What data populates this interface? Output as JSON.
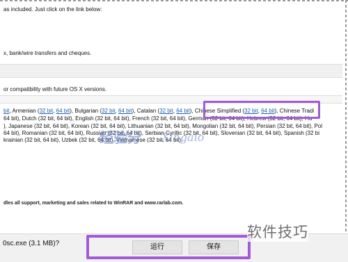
{
  "page_lines": {
    "intro": "as included. Just click on the link below:",
    "payment": "x, bank/wire transfers and cheques.",
    "compat": "or compatibility with future OS X versions."
  },
  "languages": {
    "row1": [
      {
        "prefix": ", Armenian (",
        "l1": "32 bit",
        "sep": ", ",
        "l2": "64 bit",
        "suffix": "), Bulgarian ("
      },
      {
        "prefix": "",
        "l1": "32 bit",
        "sep": ", ",
        "l2": "64 bit",
        "suffix": "), Catalan ("
      },
      {
        "prefix": "",
        "l1": "32 bit",
        "sep": ", ",
        "l2": "64 bit",
        "suffix": "), Chinese Simplified ("
      },
      {
        "prefix": "",
        "l1": "32 bit",
        "sep": ", ",
        "l2": "64 bit",
        "suffix": "), Chinese Tradi"
      }
    ],
    "row1_lead": "bit",
    "row2_text": "64 bit), Dutch (32 bit, 64 bit), English (32 bit, 64 bit), French (32 bit, 64 bit), German (32 bit, 64 bit), Hebrew (32 bit, 64 bit), Hu",
    "row3_text": "), Japanese (32 bit, 64 bit), Korean (32 bit, 64 bit), Lithuanian (32 bit, 64 bit), Mongolian (32 bit, 64 bit), Persian (32 bit, 64 bit), Pol",
    "row4_text": "64 bit), Romanian (32 bit, 64 bit), Russian (32 bit, 64 bit), Serbian Cyrillic (32 bit, 64 bit), Slovenian (32 bit, 64 bit), Spanish (32 bi",
    "row5_text": "krainian (32 bit, 64 bit), Uzbek (32 bit, 64 bit), Vietnamese (32 bit, 64 bit)."
  },
  "footer": {
    "text": "dles all support, marketing and sales related to WinRAR and www.rarlab.com."
  },
  "download_bar": {
    "file_text": "0sc.exe (3.1 MB)?",
    "run_label": "运行",
    "save_label": "保存"
  },
  "watermark": {
    "chinese": "经验分",
    "english": "Xingaio"
  },
  "brand": {
    "text": "软件技巧"
  },
  "colors": {
    "link": "#1a5fb4",
    "highlight": "#a35bd4",
    "download_bar": "#f1f1f1"
  }
}
